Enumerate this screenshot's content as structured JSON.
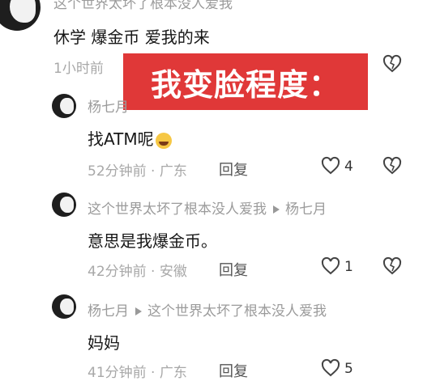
{
  "overlay_text": "我变脸程度：",
  "comments": [
    {
      "author": "这个世界太坏了根本没人爱我",
      "text": "休学 爆金币 爱我的来",
      "time": "1小时前"
    },
    {
      "author": "杨七月",
      "text": "找ATM呢",
      "emoji": "crying-laughing-emoji",
      "time": "52分钟前 · 广东",
      "reply": "回复",
      "likes": "4"
    },
    {
      "author": "这个世界太坏了根本没人爱我",
      "reply_to": "杨七月",
      "text": "意思是我爆金币。",
      "time": "42分钟前 · 安徽",
      "reply": "回复",
      "likes": "1"
    },
    {
      "author": "杨七月",
      "reply_to": "这个世界太坏了根本没人爱我",
      "text": "妈妈",
      "time": "41分钟前 · 广东",
      "reply": "回复",
      "likes": "5"
    }
  ],
  "colors": {
    "overlay": "#e03838",
    "meta": "#a8a8a8"
  }
}
